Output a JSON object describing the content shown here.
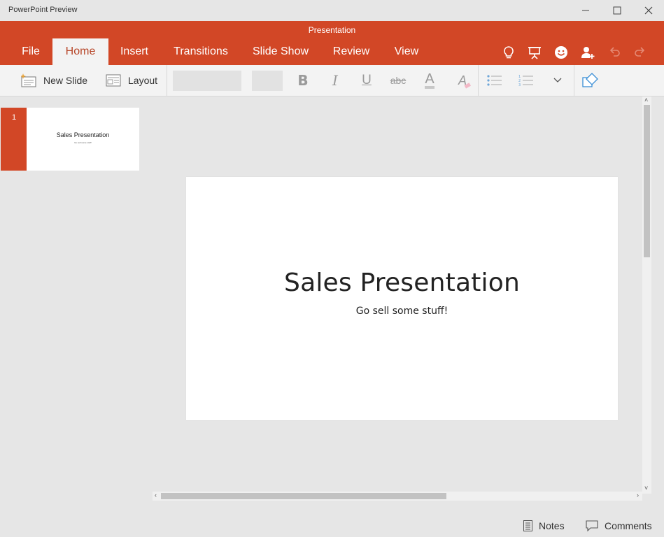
{
  "window": {
    "app_title": "PowerPoint Preview",
    "controls": [
      "minimize-icon",
      "maximize-icon",
      "close-icon"
    ]
  },
  "ribbon": {
    "document_title": "Presentation",
    "tabs": [
      {
        "label": "File"
      },
      {
        "label": "Home",
        "active": true
      },
      {
        "label": "Insert"
      },
      {
        "label": "Transitions"
      },
      {
        "label": "Slide Show"
      },
      {
        "label": "Review"
      },
      {
        "label": "View"
      }
    ],
    "right_icons": [
      "lightbulb-icon",
      "present-icon",
      "smiley-icon",
      "share-person-icon",
      "undo-icon",
      "redo-icon"
    ],
    "accent_color": "#d24726"
  },
  "toolbar": {
    "new_slide_label": "New Slide",
    "layout_label": "Layout",
    "font_name_value": "",
    "font_size_value": "",
    "format_buttons": [
      "bold-icon",
      "italic-icon",
      "underline-icon",
      "strikethrough-icon",
      "font-color-icon",
      "clear-format-icon",
      "bullets-icon",
      "numbering-icon",
      "more-chevron-icon",
      "shapes-icon"
    ],
    "bold_glyph": "B",
    "italic_glyph": "I",
    "underline_glyph": "U",
    "strike_glyph": "abc",
    "font_color_glyph": "A",
    "clear_glyph": "A"
  },
  "thumbnails": [
    {
      "number": "1",
      "title": "Sales Presentation",
      "subtitle": "Go sell some stuff!"
    }
  ],
  "slide": {
    "title": "Sales Presentation",
    "subtitle": "Go sell some stuff!"
  },
  "statusbar": {
    "notes_label": "Notes",
    "comments_label": "Comments"
  }
}
